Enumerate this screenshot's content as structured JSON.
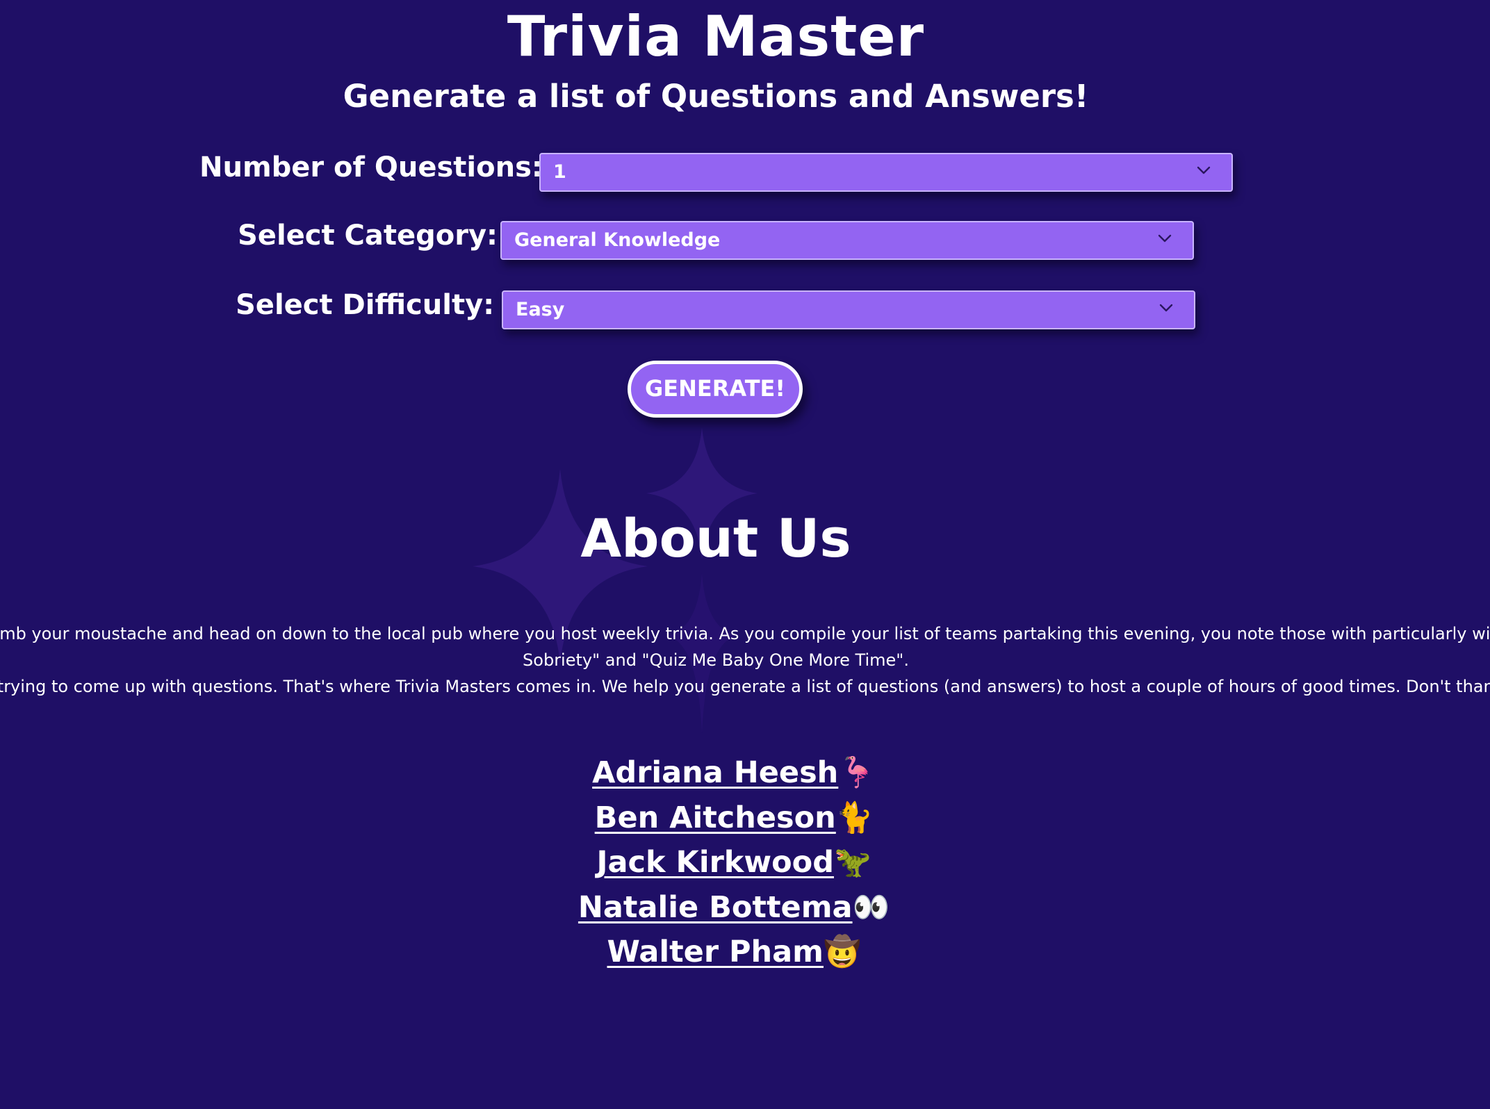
{
  "header": {
    "title": "Trivia Master",
    "subtitle": "Generate a list of Questions and Answers!"
  },
  "form": {
    "questions_label": "Number of Questions:",
    "questions_value": "1",
    "category_label": "Select Category:",
    "category_value": "General Knowledge",
    "difficulty_label": "Select Difficulty:",
    "difficulty_value": "Easy",
    "generate_label": "GENERATE!"
  },
  "about": {
    "title": "About Us",
    "lines": [
      "You put your patterned button up, comb your moustache and head on down to the local pub where you host weekly trivia. As you compile your list of teams partaking this evening, you note those with particularly witty names like \"The Sultans of",
      "Sobriety\" and \"Quiz Me Baby One More Time\".",
      "But you're on struggle street trying to come up with questions. That's where Trivia Masters comes in. We help you generate a list of questions (and answers) to host a couple of hours of good times. Don't thank us, it's our pleasure!"
    ]
  },
  "team": [
    {
      "name": "Adriana Heesh",
      "emoji": "🦩"
    },
    {
      "name": "Ben Aitcheson",
      "emoji": "🐈"
    },
    {
      "name": "Jack Kirkwood",
      "emoji": "🦖"
    },
    {
      "name": "Natalie Bottema",
      "emoji": "👀"
    },
    {
      "name": "Walter Pham",
      "emoji": "🤠"
    }
  ],
  "icons": {
    "select_arrow": "chevron-down-icon",
    "background": "sparkle-stars"
  },
  "colors": {
    "background": "#1f0f66",
    "select_fill": "#9364f2",
    "select_border": "#c9b4ff",
    "button_border": "#ffffff",
    "star": "#2e1779"
  }
}
